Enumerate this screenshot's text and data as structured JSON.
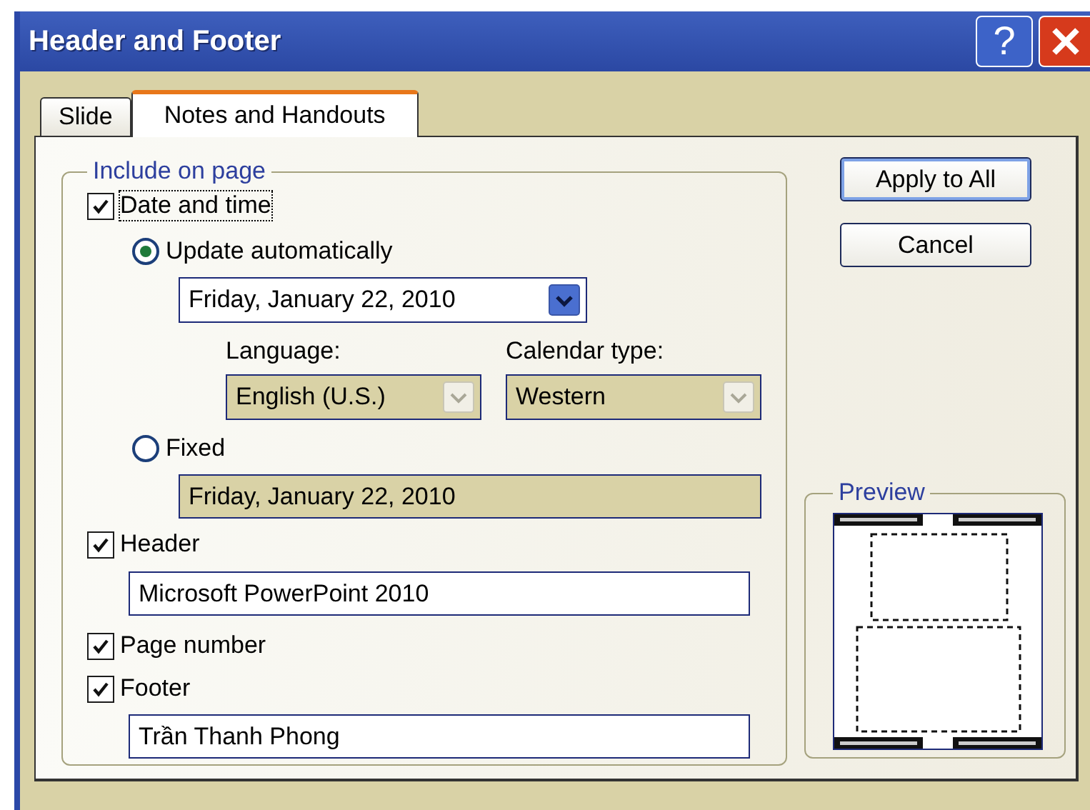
{
  "window": {
    "title": "Header and Footer",
    "help_label": "?"
  },
  "tabs": [
    {
      "label": "Slide",
      "selected": false
    },
    {
      "label": "Notes and Handouts",
      "selected": true
    }
  ],
  "include_on_page": {
    "title": "Include on page",
    "date_and_time": {
      "label": "Date and time",
      "checked": true,
      "focused": true
    },
    "update_automatically": {
      "label": "Update automatically",
      "selected": true
    },
    "date_dropdown": {
      "value": "Friday, January 22, 2010",
      "disabled": false
    },
    "language": {
      "label": "Language:",
      "value": "English (U.S.)",
      "disabled": true
    },
    "calendar_type": {
      "label": "Calendar type:",
      "value": "Western",
      "disabled": true
    },
    "fixed": {
      "label": "Fixed",
      "selected": false
    },
    "fixed_field": {
      "value": "Friday, January 22, 2010",
      "disabled": true
    },
    "header": {
      "label": "Header",
      "checked": true
    },
    "header_field": {
      "value": "Microsoft PowerPoint 2010"
    },
    "page_number": {
      "label": "Page number",
      "checked": true
    },
    "footer": {
      "label": "Footer",
      "checked": true
    },
    "footer_field": {
      "value": "Trần Thanh Phong"
    }
  },
  "buttons": [
    {
      "label": "Apply to All",
      "default": true
    },
    {
      "label": "Cancel",
      "default": false
    }
  ],
  "preview": {
    "title": "Preview"
  }
}
